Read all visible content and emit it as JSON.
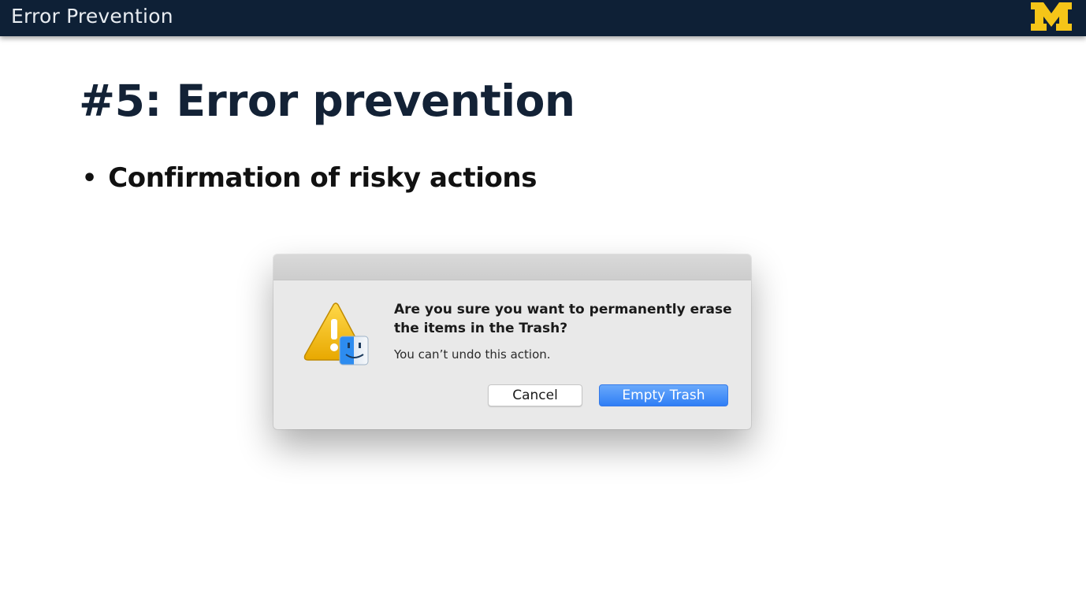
{
  "header": {
    "title": "Error Prevention",
    "logo_letter": "M",
    "logo_color": "#f5c518",
    "background_color": "#0e2036"
  },
  "slide": {
    "title": "#5: Error prevention",
    "bullets": [
      "Confirmation of risky actions"
    ]
  },
  "dialog": {
    "icon": "warning-finder-icon",
    "heading": "Are you sure you want to permanently erase the items in the Trash?",
    "message": "You can’t undo this action.",
    "cancel_label": "Cancel",
    "confirm_label": "Empty Trash",
    "confirm_color": "#2f7ef5"
  }
}
